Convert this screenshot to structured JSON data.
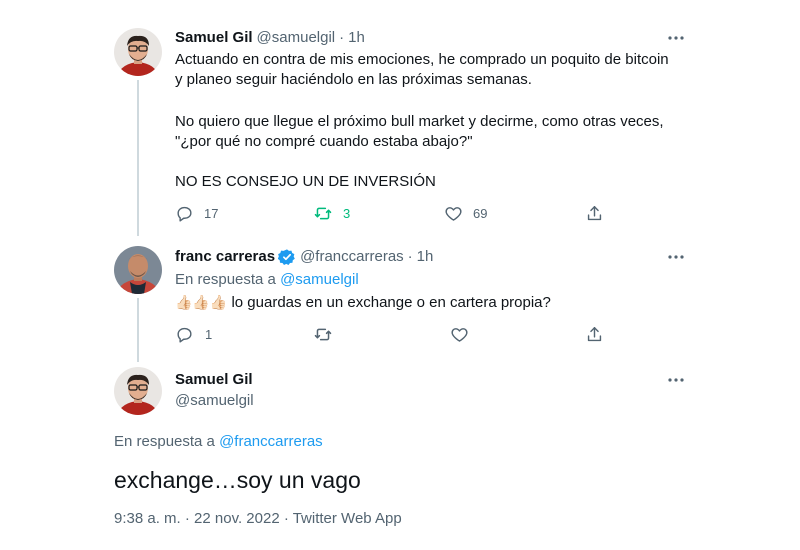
{
  "tweet1": {
    "name": "Samuel Gil",
    "handle": "@samuelgil",
    "dot": "·",
    "time": "1h",
    "line1": "Actuando en contra de mis emociones, he comprado un poquito de bitcoin",
    "line2": "y planeo seguir haciéndolo en las próximas semanas.",
    "line3": "No quiero que llegue el próximo bull market y decirme, como otras veces,",
    "line4": "\"¿por qué no compré cuando estaba abajo?\"",
    "line5": "NO ES CONSEJO UN DE INVERSIÓN",
    "replies": "17",
    "retweets": "3",
    "likes": "69"
  },
  "tweet2": {
    "name": "franc carreras",
    "handle": "@franccarreras",
    "dot": "·",
    "time": "1h",
    "reply_prefix": "En respuesta a",
    "reply_user": "@samuelgil",
    "emojis": "👍🏻👍🏻👍🏻",
    "text": "lo guardas en un exchange o en cartera propia?",
    "replies": "1"
  },
  "tweet3": {
    "name": "Samuel Gil",
    "handle": "@samuelgil",
    "reply_prefix": "En respuesta a",
    "reply_user": "@franccarreras",
    "text": "exchange…soy un vago",
    "meta": "9:38 a. m. · 22 nov. 2022 · Twitter Web App"
  },
  "colors": {
    "link": "#1d9bf0",
    "secondary": "#536471",
    "retweet_active": "#00ba7c",
    "verified": "#1d9bf0"
  }
}
